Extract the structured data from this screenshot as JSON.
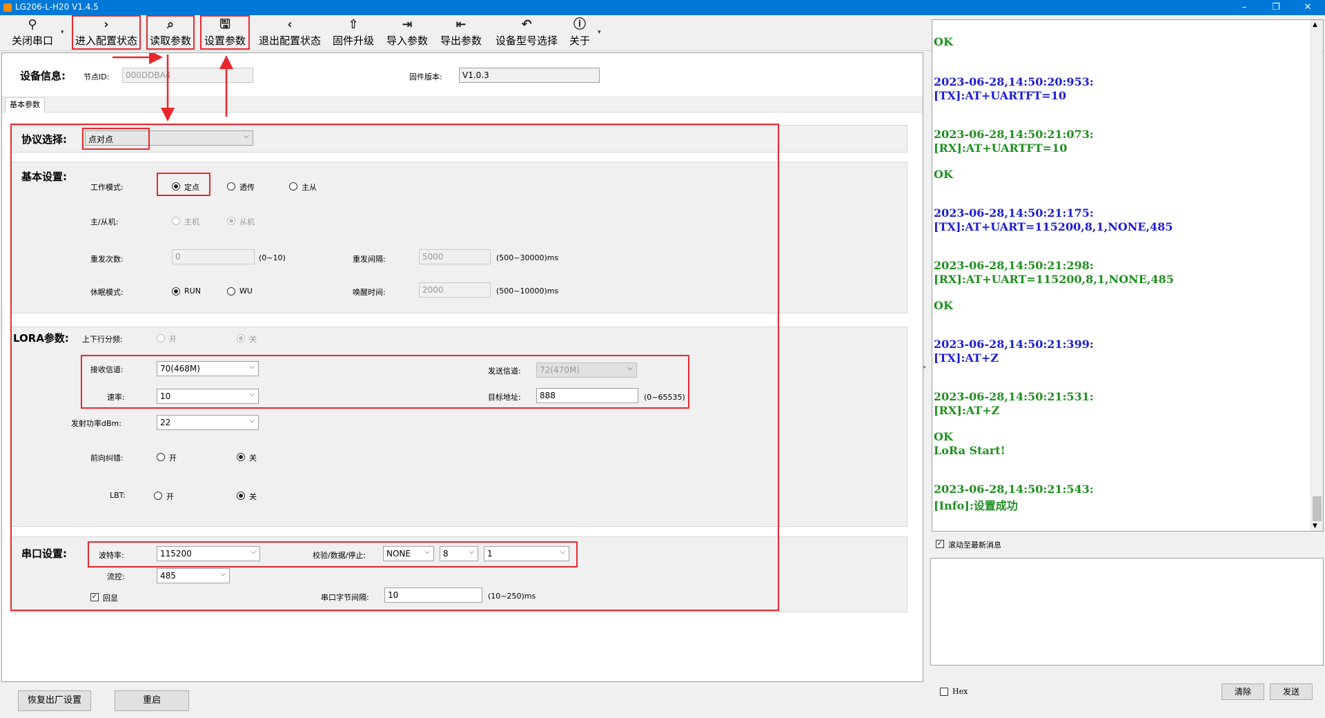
{
  "window": {
    "title": "LG206-L-H20 V1.4.5",
    "minimize": "–",
    "maximize": "❐",
    "close": "✕"
  },
  "toolbar": [
    {
      "icon": "⚲",
      "label": "关闭串口"
    },
    {
      "icon": "›",
      "label": "进入配置状态"
    },
    {
      "icon": "⌕",
      "label": "读取参数"
    },
    {
      "icon": "🖫",
      "label": "设置参数"
    },
    {
      "icon": "‹",
      "label": "退出配置状态"
    },
    {
      "icon": "⇧",
      "label": "固件升级"
    },
    {
      "icon": "⇥",
      "label": "导入参数"
    },
    {
      "icon": "⇤",
      "label": "导出参数"
    },
    {
      "icon": "↶",
      "label": "设备型号选择"
    },
    {
      "icon": "ⓘ",
      "label": "关于"
    }
  ],
  "device_info": {
    "title": "设备信息:",
    "node_id_label": "节点ID:",
    "node_id_value": "000DDBA4",
    "firmware_label": "固件版本:",
    "firmware_value": "V1.0.3"
  },
  "tab": "基本参数",
  "protocol": {
    "label": "协议选择:",
    "value": "点对点"
  },
  "basic": {
    "title": "基本设置:",
    "work_mode_label": "工作模式:",
    "work_mode_options": [
      "定点",
      "透传",
      "主从"
    ],
    "role_label": "主/从机:",
    "role_options": [
      "主机",
      "从机"
    ],
    "retry_label": "重发次数:",
    "retry_value": "0",
    "retry_range": "(0~10)",
    "retry_interval_label": "重发间隔:",
    "retry_interval_value": "5000",
    "retry_interval_range": "(500~30000)ms",
    "sleep_label": "休眠模式:",
    "sleep_options": [
      "RUN",
      "WU"
    ],
    "wake_label": "唤醒时间:",
    "wake_value": "2000",
    "wake_range": "(500~10000)ms"
  },
  "lora": {
    "title": "LORA参数:",
    "updown_label": "上下行分频:",
    "updown_options": [
      "开",
      "关"
    ],
    "rx_channel_label": "接收信道:",
    "rx_channel_value": "70(468M)",
    "tx_channel_label": "发送信道:",
    "tx_channel_value": "72(470M)",
    "rate_label": "速率:",
    "rate_value": "10",
    "target_label": "目标地址:",
    "target_value": "888",
    "target_range": "(0~65535)",
    "power_label": "发射功率dBm:",
    "power_value": "22",
    "fec_label": "前向纠错:",
    "fec_options": [
      "开",
      "关"
    ],
    "lbt_label": "LBT:",
    "lbt_options": [
      "开",
      "关"
    ]
  },
  "serial": {
    "title": "串口设置:",
    "baud_label": "波特率:",
    "baud_value": "115200",
    "parity_label": "校验/数据/停止:",
    "parity_value": "NONE",
    "data_value": "8",
    "stop_value": "1",
    "flow_label": "流控:",
    "flow_value": "485",
    "echo_label": "回显",
    "gap_label": "串口字节间隔:",
    "gap_value": "10",
    "gap_range": "(10~250)ms"
  },
  "bottom_buttons": {
    "factory_reset": "恢复出厂设置",
    "restart": "重启"
  },
  "log": [
    {
      "text": "OK",
      "color": "green"
    },
    {
      "text": "2023-06-28,14:50:20:953:",
      "color": "blue"
    },
    {
      "text": "[TX]:AT+UARTFT=10",
      "color": "blue"
    },
    {
      "text": "2023-06-28,14:50:21:073:",
      "color": "green"
    },
    {
      "text": "[RX]:AT+UARTFT=10",
      "color": "green"
    },
    {
      "text": "OK",
      "color": "green"
    },
    {
      "text": "2023-06-28,14:50:21:175:",
      "color": "blue"
    },
    {
      "text": "[TX]:AT+UART=115200,8,1,NONE,485",
      "color": "blue"
    },
    {
      "text": "2023-06-28,14:50:21:298:",
      "color": "green"
    },
    {
      "text": "[RX]:AT+UART=115200,8,1,NONE,485",
      "color": "green"
    },
    {
      "text": "OK",
      "color": "green"
    },
    {
      "text": "2023-06-28,14:50:21:399:",
      "color": "blue"
    },
    {
      "text": "[TX]:AT+Z",
      "color": "blue"
    },
    {
      "text": "2023-06-28,14:50:21:531:",
      "color": "green"
    },
    {
      "text": "[RX]:AT+Z",
      "color": "green"
    },
    {
      "text": "OK",
      "color": "green"
    },
    {
      "text": "LoRa Start!",
      "color": "green"
    },
    {
      "text": "2023-06-28,14:50:21:543:",
      "color": "green"
    },
    {
      "text": "[Info]:设置成功",
      "color": "green"
    }
  ],
  "right_panel": {
    "autoscroll_label": "滚动至最新消息",
    "hex_label": "Hex",
    "clear_button": "清除",
    "send_button": "发送"
  },
  "colors": {
    "titlebar": "#0078d7",
    "annotation_red": "#e8272d",
    "log_green": "#1d8f1d",
    "log_blue": "#1c1cd4"
  }
}
